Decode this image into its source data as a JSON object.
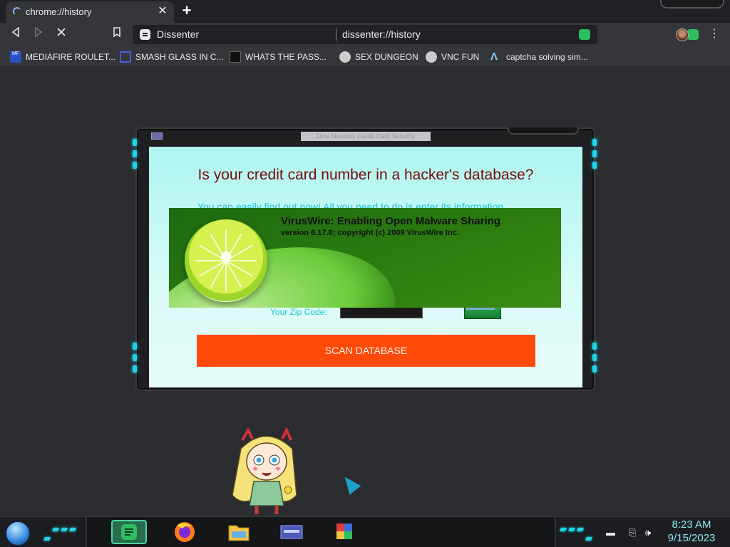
{
  "browser": {
    "tab": {
      "title": "chrome://history"
    },
    "omnibox": {
      "site_name": "Dissenter",
      "url": "dissenter://history"
    },
    "bookmarks": [
      {
        "label": "MEDIAFIRE ROULET...",
        "icon": "mediafire-icon"
      },
      {
        "label": "SMASH GLASS IN C...",
        "icon": "glass-icon"
      },
      {
        "label": "WHATS THE PASS...",
        "icon": "lock-icon"
      },
      {
        "label": "SEX DUNGEON",
        "icon": "dungeon-icon"
      },
      {
        "label": "VNC FUN",
        "icon": "vnc-icon"
      },
      {
        "label": "captcha solving sim...",
        "icon": "captcha-icon"
      }
    ]
  },
  "window": {
    "title": "Dine Nervous Credit Card Security"
  },
  "scam_page": {
    "headline": "Is your credit card number in a hacker's database?",
    "subtext": "You can easily find out now! All you need to do is enter its information",
    "zip_label": "Your Zip Code:",
    "zip_value": "",
    "scan_button": "SCAN DATABASE"
  },
  "splash": {
    "title": "VirusWire: Enabling Open Malware Sharing",
    "version": "version 6.17.0; copyright (c) 2009 VirusWire Inc."
  },
  "taskbar": {
    "time": "8:23 AM",
    "date": "9/15/2023"
  },
  "colors": {
    "accent_cyan": "#1ed4e8",
    "scan_button": "#ff4a0a",
    "headline": "#7a0a0a",
    "splash_green": "#2a7a10"
  }
}
